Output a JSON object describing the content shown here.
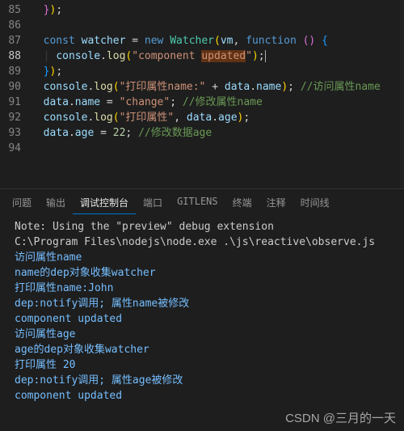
{
  "editor": {
    "lines": [
      {
        "n": 85,
        "tokens": [
          {
            "t": "  ",
            "cls": ""
          },
          {
            "t": "}",
            "cls": "tok-brk1"
          },
          {
            "t": ")",
            "cls": "tok-brk"
          },
          {
            "t": ";",
            "cls": "tok-pun"
          }
        ]
      },
      {
        "n": 86,
        "tokens": []
      },
      {
        "n": 87,
        "tokens": [
          {
            "t": "  ",
            "cls": ""
          },
          {
            "t": "const",
            "cls": "tok-kw"
          },
          {
            "t": " ",
            "cls": ""
          },
          {
            "t": "watcher",
            "cls": "tok-var"
          },
          {
            "t": " = ",
            "cls": "tok-pun"
          },
          {
            "t": "new",
            "cls": "tok-kw"
          },
          {
            "t": " ",
            "cls": ""
          },
          {
            "t": "Watcher",
            "cls": "tok-cls"
          },
          {
            "t": "(",
            "cls": "tok-brk"
          },
          {
            "t": "vm",
            "cls": "tok-var"
          },
          {
            "t": ", ",
            "cls": "tok-pun"
          },
          {
            "t": "function",
            "cls": "tok-kw"
          },
          {
            "t": " ",
            "cls": ""
          },
          {
            "t": "()",
            "cls": "tok-brk1"
          },
          {
            "t": " ",
            "cls": ""
          },
          {
            "t": "{",
            "cls": "tok-brk2"
          }
        ]
      },
      {
        "n": 88,
        "current": true,
        "tokens": [
          {
            "t": "  ",
            "cls": ""
          },
          {
            "t": "|",
            "cls": "indent-guide"
          },
          {
            "t": " ",
            "cls": ""
          },
          {
            "t": "console",
            "cls": "tok-var"
          },
          {
            "t": ".",
            "cls": "tok-pun"
          },
          {
            "t": "log",
            "cls": "tok-fn"
          },
          {
            "t": "(",
            "cls": "tok-brk"
          },
          {
            "t": "\"component ",
            "cls": "tok-str"
          },
          {
            "t": "updated",
            "cls": "tok-str hl"
          },
          {
            "t": "\"",
            "cls": "tok-str"
          },
          {
            "t": ")",
            "cls": "tok-brk"
          },
          {
            "t": ";",
            "cls": "tok-pun cursor"
          }
        ]
      },
      {
        "n": 89,
        "tokens": [
          {
            "t": "  ",
            "cls": ""
          },
          {
            "t": "}",
            "cls": "tok-brk2"
          },
          {
            "t": ")",
            "cls": "tok-brk"
          },
          {
            "t": ";",
            "cls": "tok-pun"
          }
        ]
      },
      {
        "n": 90,
        "tokens": [
          {
            "t": "  ",
            "cls": ""
          },
          {
            "t": "console",
            "cls": "tok-var"
          },
          {
            "t": ".",
            "cls": "tok-pun"
          },
          {
            "t": "log",
            "cls": "tok-fn"
          },
          {
            "t": "(",
            "cls": "tok-brk"
          },
          {
            "t": "\"打印属性name:\"",
            "cls": "tok-str"
          },
          {
            "t": " + ",
            "cls": "tok-pun"
          },
          {
            "t": "data",
            "cls": "tok-var"
          },
          {
            "t": ".",
            "cls": "tok-pun"
          },
          {
            "t": "name",
            "cls": "tok-var"
          },
          {
            "t": ")",
            "cls": "tok-brk"
          },
          {
            "t": "; ",
            "cls": "tok-pun"
          },
          {
            "t": "//访问属性name",
            "cls": "tok-cmt"
          }
        ]
      },
      {
        "n": 91,
        "tokens": [
          {
            "t": "  ",
            "cls": ""
          },
          {
            "t": "data",
            "cls": "tok-var"
          },
          {
            "t": ".",
            "cls": "tok-pun"
          },
          {
            "t": "name",
            "cls": "tok-var"
          },
          {
            "t": " = ",
            "cls": "tok-pun"
          },
          {
            "t": "\"change\"",
            "cls": "tok-str"
          },
          {
            "t": "; ",
            "cls": "tok-pun"
          },
          {
            "t": "//修改属性name",
            "cls": "tok-cmt"
          }
        ]
      },
      {
        "n": 92,
        "tokens": [
          {
            "t": "  ",
            "cls": ""
          },
          {
            "t": "console",
            "cls": "tok-var"
          },
          {
            "t": ".",
            "cls": "tok-pun"
          },
          {
            "t": "log",
            "cls": "tok-fn"
          },
          {
            "t": "(",
            "cls": "tok-brk"
          },
          {
            "t": "\"打印属性\"",
            "cls": "tok-str"
          },
          {
            "t": ", ",
            "cls": "tok-pun"
          },
          {
            "t": "data",
            "cls": "tok-var"
          },
          {
            "t": ".",
            "cls": "tok-pun"
          },
          {
            "t": "age",
            "cls": "tok-var"
          },
          {
            "t": ")",
            "cls": "tok-brk"
          },
          {
            "t": ";",
            "cls": "tok-pun"
          }
        ]
      },
      {
        "n": 93,
        "tokens": [
          {
            "t": "  ",
            "cls": ""
          },
          {
            "t": "data",
            "cls": "tok-var"
          },
          {
            "t": ".",
            "cls": "tok-pun"
          },
          {
            "t": "age",
            "cls": "tok-var"
          },
          {
            "t": " = ",
            "cls": "tok-pun"
          },
          {
            "t": "22",
            "cls": "tok-num"
          },
          {
            "t": "; ",
            "cls": "tok-pun"
          },
          {
            "t": "//修改数据age",
            "cls": "tok-cmt"
          }
        ]
      },
      {
        "n": 94,
        "tokens": []
      }
    ]
  },
  "panel": {
    "tabs": [
      "问题",
      "输出",
      "调试控制台",
      "端口",
      "GITLENS",
      "终端",
      "注释",
      "时间线"
    ],
    "active": 2,
    "lines": [
      {
        "cls": "c-note",
        "t": "Note: Using the \"preview\" debug extension"
      },
      {
        "cls": "c-note",
        "t": "C:\\Program Files\\nodejs\\node.exe .\\js\\reactive\\observe.js"
      },
      {
        "cls": "c-info",
        "t": "访问属性name"
      },
      {
        "cls": "c-info",
        "t": "name的dep对象收集watcher"
      },
      {
        "cls": "c-info",
        "t": "打印属性name:John"
      },
      {
        "cls": "c-info",
        "t": "dep:notify调用; 属性name被修改"
      },
      {
        "cls": "c-info",
        "t": "component updated"
      },
      {
        "cls": "c-info",
        "t": "访问属性age"
      },
      {
        "cls": "c-info",
        "t": "age的dep对象收集watcher"
      },
      {
        "cls": "c-info",
        "t": "打印属性 20"
      },
      {
        "cls": "c-info",
        "t": "dep:notify调用; 属性age被修改"
      },
      {
        "cls": "c-info",
        "t": "component updated"
      }
    ]
  },
  "watermark": "CSDN @三月的一天"
}
